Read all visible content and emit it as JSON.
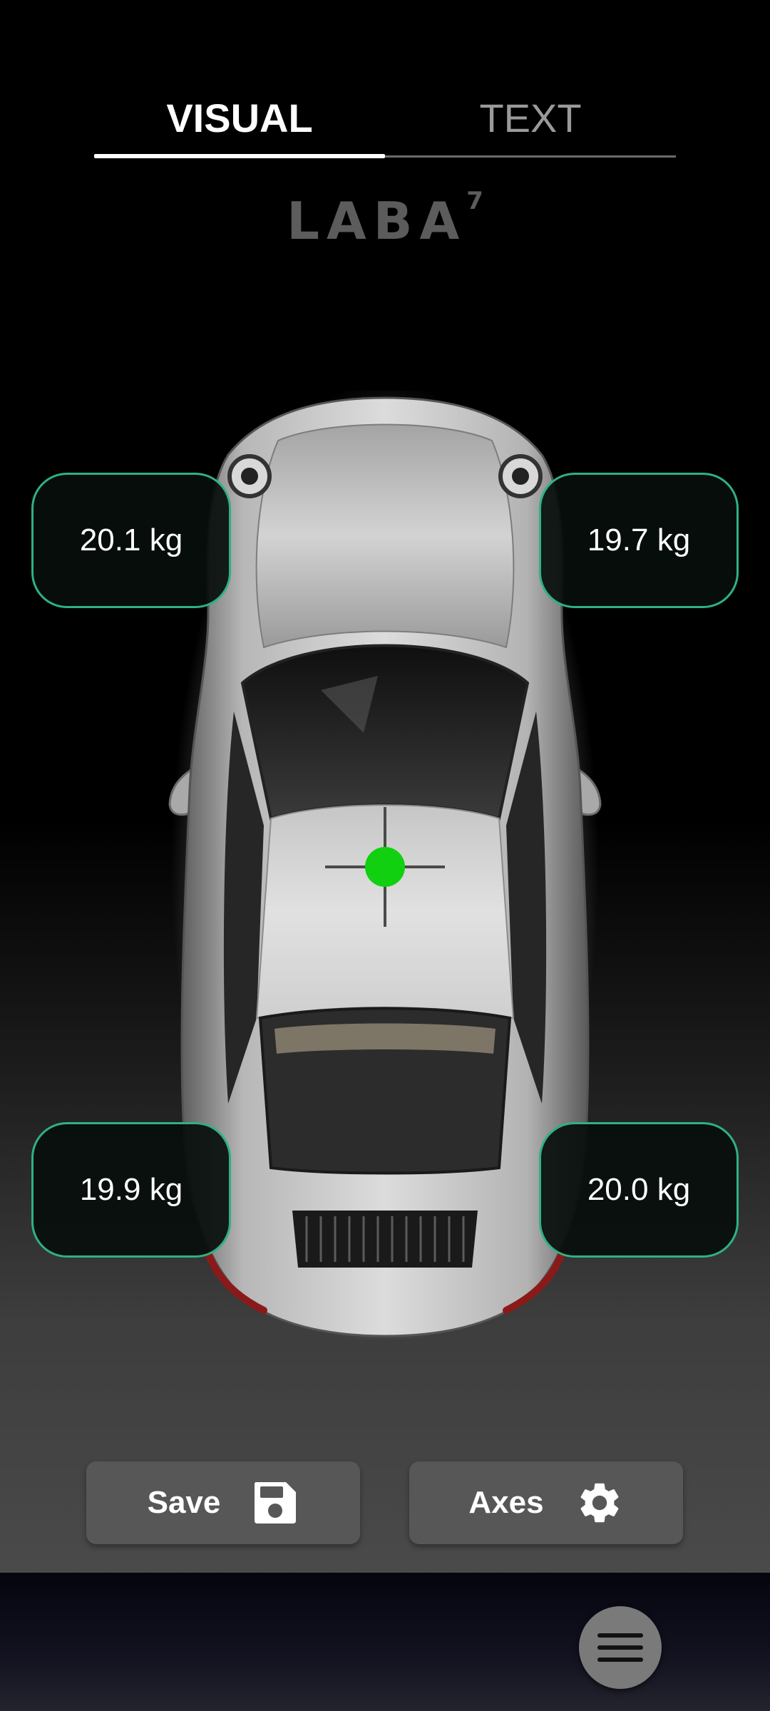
{
  "tabs": {
    "visual_label": "VISUAL",
    "text_label": "TEXT",
    "active": "VISUAL"
  },
  "logo": {
    "text": "LABA",
    "superscript": "7"
  },
  "weights": {
    "front_left": "20.1 kg",
    "front_right": "19.7 kg",
    "rear_left": "19.9 kg",
    "rear_right": "20.0 kg"
  },
  "buttons": {
    "save_label": "Save",
    "axes_label": "Axes"
  },
  "icons": {
    "save": "floppy-disk-icon",
    "axes": "gear-icon",
    "menu": "hamburger-menu-icon"
  },
  "colors": {
    "box_border": "#2fb183",
    "center_of_gravity_dot": "#10d010",
    "tab_active": "#ffffff",
    "tab_inactive": "#9a9a9a"
  }
}
